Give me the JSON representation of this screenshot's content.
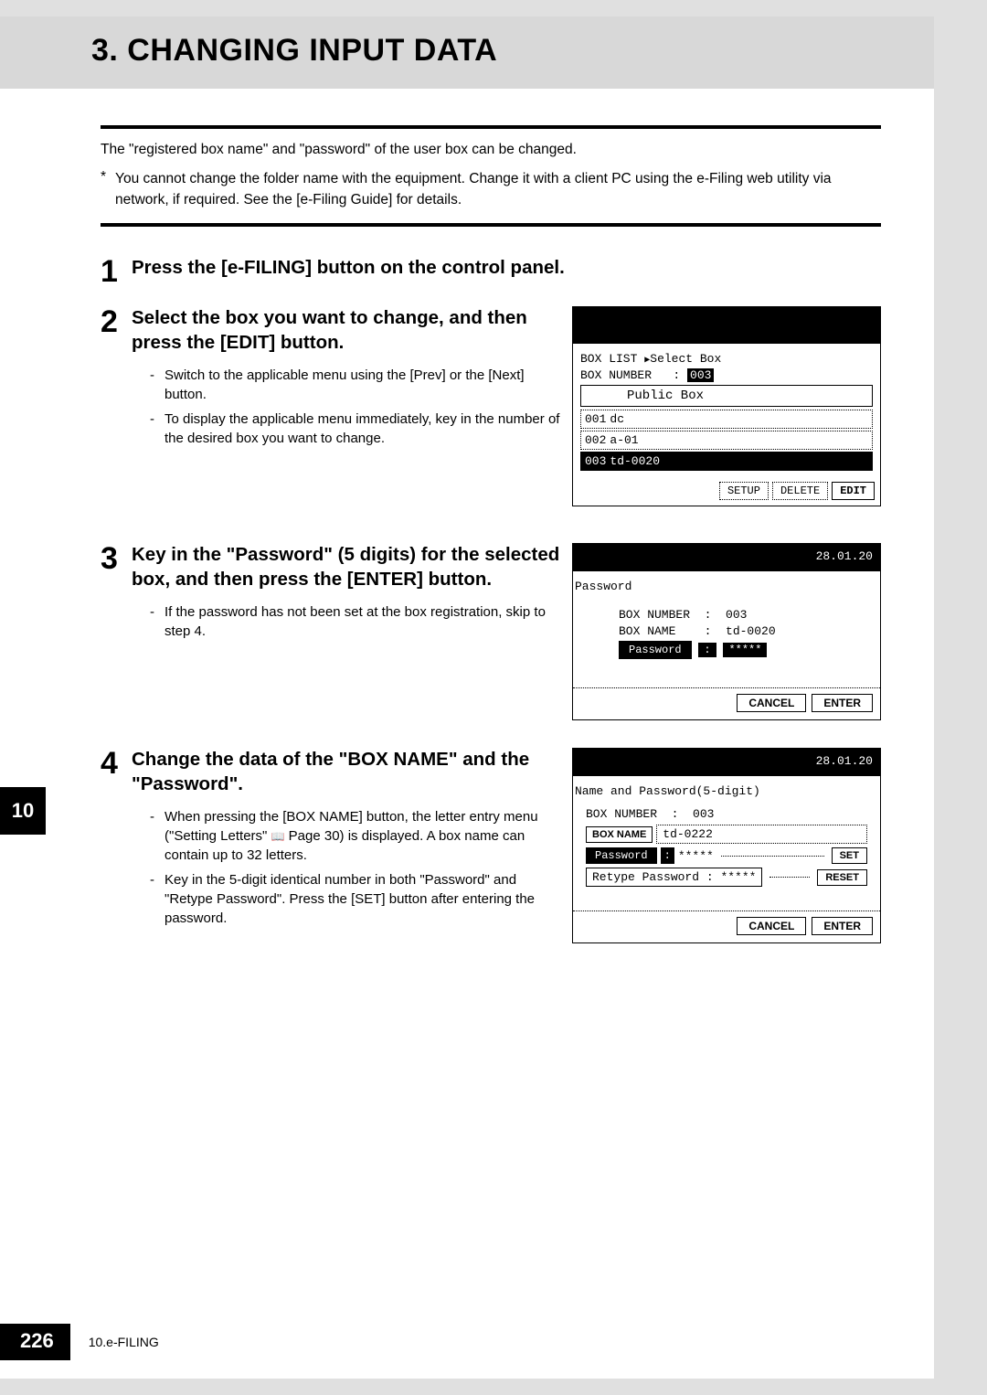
{
  "header": {
    "title": "3. CHANGING INPUT DATA"
  },
  "intro": "The \"registered box name\" and \"password\" of the user box can be changed.",
  "note": "You cannot change the folder name with the equipment. Change it with a client PC using the e-Filing web utility via network, if required. See the [e-Filing Guide] for details.",
  "steps": [
    {
      "num": "1",
      "title": "Press the [e-FILING] button on the control panel.",
      "bullets": []
    },
    {
      "num": "2",
      "title": "Select the box you want to change, and then press the [EDIT] button.",
      "bullets": [
        "Switch to the applicable menu using the [Prev] or the [Next] button.",
        "To display the applicable menu immediately, key in the number of the desired box you want to change."
      ]
    },
    {
      "num": "3",
      "title": "Key in the \"Password\" (5 digits) for the selected box, and then press the [ENTER] button.",
      "bullets": [
        "If the password has not been set at the box registration, skip to step 4."
      ]
    },
    {
      "num": "4",
      "title": "Change the data of the \"BOX NAME\" and the \"Password\".",
      "bullets": [
        "When pressing the [BOX NAME] button, the letter entry menu (\"Setting Letters\" — Page 30) is displayed. A box name can contain up to 32 letters.",
        "Key in the 5-digit identical number in both \"Password\" and \"Retype Password\". Press the [SET] button after entering the password."
      ]
    }
  ],
  "screen2": {
    "breadcrumb_a": "BOX LIST",
    "breadcrumb_b": "Select Box",
    "boxnum_label": "BOX NUMBER",
    "boxnum_value": "003",
    "public": "Public Box",
    "rows": [
      {
        "id": "001",
        "name": "dc"
      },
      {
        "id": "002",
        "name": "a-01"
      },
      {
        "id": "003",
        "name": "td-0020"
      }
    ],
    "btns": {
      "setup": "SETUP",
      "delete": "DELETE",
      "edit": "EDIT"
    }
  },
  "screen3": {
    "date": "28.01.20",
    "title": "Password",
    "boxnum_label": "BOX NUMBER",
    "boxnum_value": "003",
    "boxname_label": "BOX NAME",
    "boxname_value": "td-0020",
    "password_label": "Password",
    "password_value": "*****",
    "btns": {
      "cancel": "CANCEL",
      "enter": "ENTER"
    }
  },
  "screen4": {
    "date": "28.01.20",
    "title": "Name and Password(5-digit)",
    "boxnum_label": "BOX NUMBER",
    "boxnum_value": "003",
    "boxname_btn": "BOX NAME",
    "boxname_value": "td-0222",
    "password_label": "Password",
    "password_value": "*****",
    "retype_label": "Retype Password",
    "retype_value": "*****",
    "btns": {
      "set": "SET",
      "reset": "RESET",
      "cancel": "CANCEL",
      "enter": "ENTER"
    }
  },
  "chapter_tab": "10",
  "footer": {
    "page": "226",
    "section": "10.e-FILING"
  }
}
